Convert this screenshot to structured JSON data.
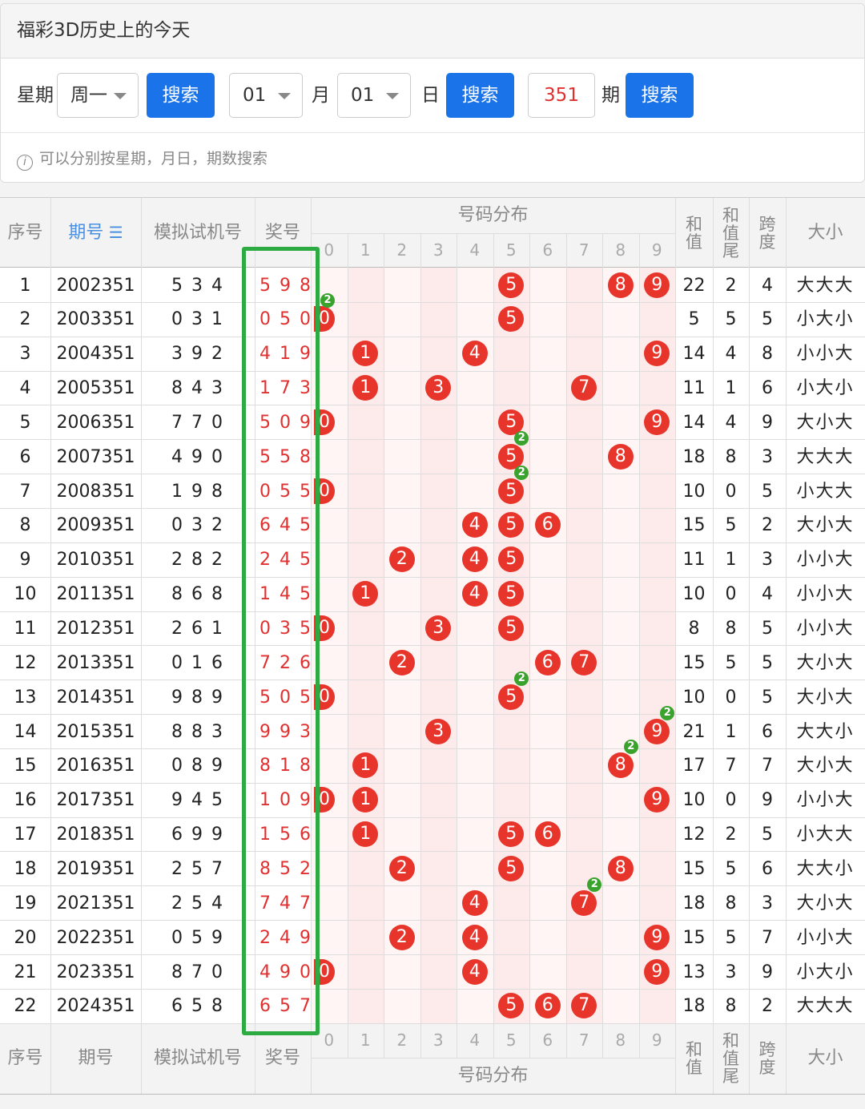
{
  "panel": {
    "title": "福彩3D历史上的今天",
    "weekday_label": "星期",
    "weekday_value": "周一",
    "search_label": "搜索",
    "month_value": "01",
    "month_label": "月",
    "day_value": "01",
    "day_label": "日",
    "issue_value": "351",
    "issue_label": "期",
    "hint": "可以分别按星期，月日，期数搜索"
  },
  "table": {
    "headers": {
      "seq": "序号",
      "issue": "期号",
      "sim": "模拟试机号",
      "prize": "奖号",
      "dist": "号码分布",
      "sum": "和值",
      "sum_tail": "和值尾",
      "span": "跨度",
      "size": "大小"
    },
    "digits": [
      "0",
      "1",
      "2",
      "3",
      "4",
      "5",
      "6",
      "7",
      "8",
      "9"
    ],
    "rows": [
      {
        "seq": "1",
        "issue": "2002351",
        "sim": "5 3 4",
        "prize": "5 9 8",
        "balls": [
          5,
          8,
          9
        ],
        "badges": [],
        "sum": "22",
        "tail": "2",
        "span": "4",
        "size": "大大大"
      },
      {
        "seq": "2",
        "issue": "2003351",
        "sim": "0 3 1",
        "prize": "0 5 0",
        "balls": [
          0,
          5
        ],
        "badges": [
          0
        ],
        "sum": "5",
        "tail": "5",
        "span": "5",
        "size": "小大小"
      },
      {
        "seq": "3",
        "issue": "2004351",
        "sim": "3 9 2",
        "prize": "4 1 9",
        "balls": [
          1,
          4,
          9
        ],
        "badges": [],
        "sum": "14",
        "tail": "4",
        "span": "8",
        "size": "小小大"
      },
      {
        "seq": "4",
        "issue": "2005351",
        "sim": "8 4 3",
        "prize": "1 7 3",
        "balls": [
          1,
          3,
          7
        ],
        "badges": [],
        "sum": "11",
        "tail": "1",
        "span": "6",
        "size": "小大小"
      },
      {
        "seq": "5",
        "issue": "2006351",
        "sim": "7 7 0",
        "prize": "5 0 9",
        "balls": [
          0,
          5,
          9
        ],
        "badges": [],
        "sum": "14",
        "tail": "4",
        "span": "9",
        "size": "大小大"
      },
      {
        "seq": "6",
        "issue": "2007351",
        "sim": "4 9 0",
        "prize": "5 5 8",
        "balls": [
          5,
          8
        ],
        "badges": [
          5
        ],
        "sum": "18",
        "tail": "8",
        "span": "3",
        "size": "大大大"
      },
      {
        "seq": "7",
        "issue": "2008351",
        "sim": "1 9 8",
        "prize": "0 5 5",
        "balls": [
          0,
          5
        ],
        "badges": [
          5
        ],
        "sum": "10",
        "tail": "0",
        "span": "5",
        "size": "小大大"
      },
      {
        "seq": "8",
        "issue": "2009351",
        "sim": "0 3 2",
        "prize": "6 4 5",
        "balls": [
          4,
          5,
          6
        ],
        "badges": [],
        "sum": "15",
        "tail": "5",
        "span": "2",
        "size": "大小大"
      },
      {
        "seq": "9",
        "issue": "2010351",
        "sim": "2 8 2",
        "prize": "2 4 5",
        "balls": [
          2,
          4,
          5
        ],
        "badges": [],
        "sum": "11",
        "tail": "1",
        "span": "3",
        "size": "小小大"
      },
      {
        "seq": "10",
        "issue": "2011351",
        "sim": "8 6 8",
        "prize": "1 4 5",
        "balls": [
          1,
          4,
          5
        ],
        "badges": [],
        "sum": "10",
        "tail": "0",
        "span": "4",
        "size": "小小大"
      },
      {
        "seq": "11",
        "issue": "2012351",
        "sim": "2 6 1",
        "prize": "0 3 5",
        "balls": [
          0,
          3,
          5
        ],
        "badges": [],
        "sum": "8",
        "tail": "8",
        "span": "5",
        "size": "小小大"
      },
      {
        "seq": "12",
        "issue": "2013351",
        "sim": "0 1 6",
        "prize": "7 2 6",
        "balls": [
          2,
          6,
          7
        ],
        "badges": [],
        "sum": "15",
        "tail": "5",
        "span": "5",
        "size": "大小大"
      },
      {
        "seq": "13",
        "issue": "2014351",
        "sim": "9 8 9",
        "prize": "5 0 5",
        "balls": [
          0,
          5
        ],
        "badges": [
          5
        ],
        "sum": "10",
        "tail": "0",
        "span": "5",
        "size": "大小大"
      },
      {
        "seq": "14",
        "issue": "2015351",
        "sim": "8 8 3",
        "prize": "9 9 3",
        "balls": [
          3,
          9
        ],
        "badges": [
          9
        ],
        "sum": "21",
        "tail": "1",
        "span": "6",
        "size": "大大小"
      },
      {
        "seq": "15",
        "issue": "2016351",
        "sim": "0 8 9",
        "prize": "8 1 8",
        "balls": [
          1,
          8
        ],
        "badges": [
          8
        ],
        "sum": "17",
        "tail": "7",
        "span": "7",
        "size": "大小大"
      },
      {
        "seq": "16",
        "issue": "2017351",
        "sim": "9 4 5",
        "prize": "1 0 9",
        "balls": [
          0,
          1,
          9
        ],
        "badges": [],
        "sum": "10",
        "tail": "0",
        "span": "9",
        "size": "小小大"
      },
      {
        "seq": "17",
        "issue": "2018351",
        "sim": "6 9 9",
        "prize": "1 5 6",
        "balls": [
          1,
          5,
          6
        ],
        "badges": [],
        "sum": "12",
        "tail": "2",
        "span": "5",
        "size": "小大大"
      },
      {
        "seq": "18",
        "issue": "2019351",
        "sim": "2 5 7",
        "prize": "8 5 2",
        "balls": [
          2,
          5,
          8
        ],
        "badges": [],
        "sum": "15",
        "tail": "5",
        "span": "6",
        "size": "大大小"
      },
      {
        "seq": "19",
        "issue": "2021351",
        "sim": "2 5 4",
        "prize": "7 4 7",
        "balls": [
          4,
          7
        ],
        "badges": [
          7
        ],
        "sum": "18",
        "tail": "8",
        "span": "3",
        "size": "大小大"
      },
      {
        "seq": "20",
        "issue": "2022351",
        "sim": "0 5 9",
        "prize": "2 4 9",
        "balls": [
          2,
          4,
          9
        ],
        "badges": [],
        "sum": "15",
        "tail": "5",
        "span": "7",
        "size": "小小大"
      },
      {
        "seq": "21",
        "issue": "2023351",
        "sim": "8 7 0",
        "prize": "4 9 0",
        "balls": [
          0,
          4,
          9
        ],
        "badges": [],
        "sum": "13",
        "tail": "3",
        "span": "9",
        "size": "小大小"
      },
      {
        "seq": "22",
        "issue": "2024351",
        "sim": "6 5 8",
        "prize": "6 5 7",
        "balls": [
          5,
          6,
          7
        ],
        "badges": [],
        "sum": "18",
        "tail": "8",
        "span": "2",
        "size": "大大大"
      }
    ],
    "badge_count": "2",
    "sort_icon": "sort-desc-icon",
    "colors": {
      "ball": "#e8352b",
      "badge": "#3aa32e",
      "highlight": "#2eaa43",
      "accent": "#1a73e8"
    }
  }
}
